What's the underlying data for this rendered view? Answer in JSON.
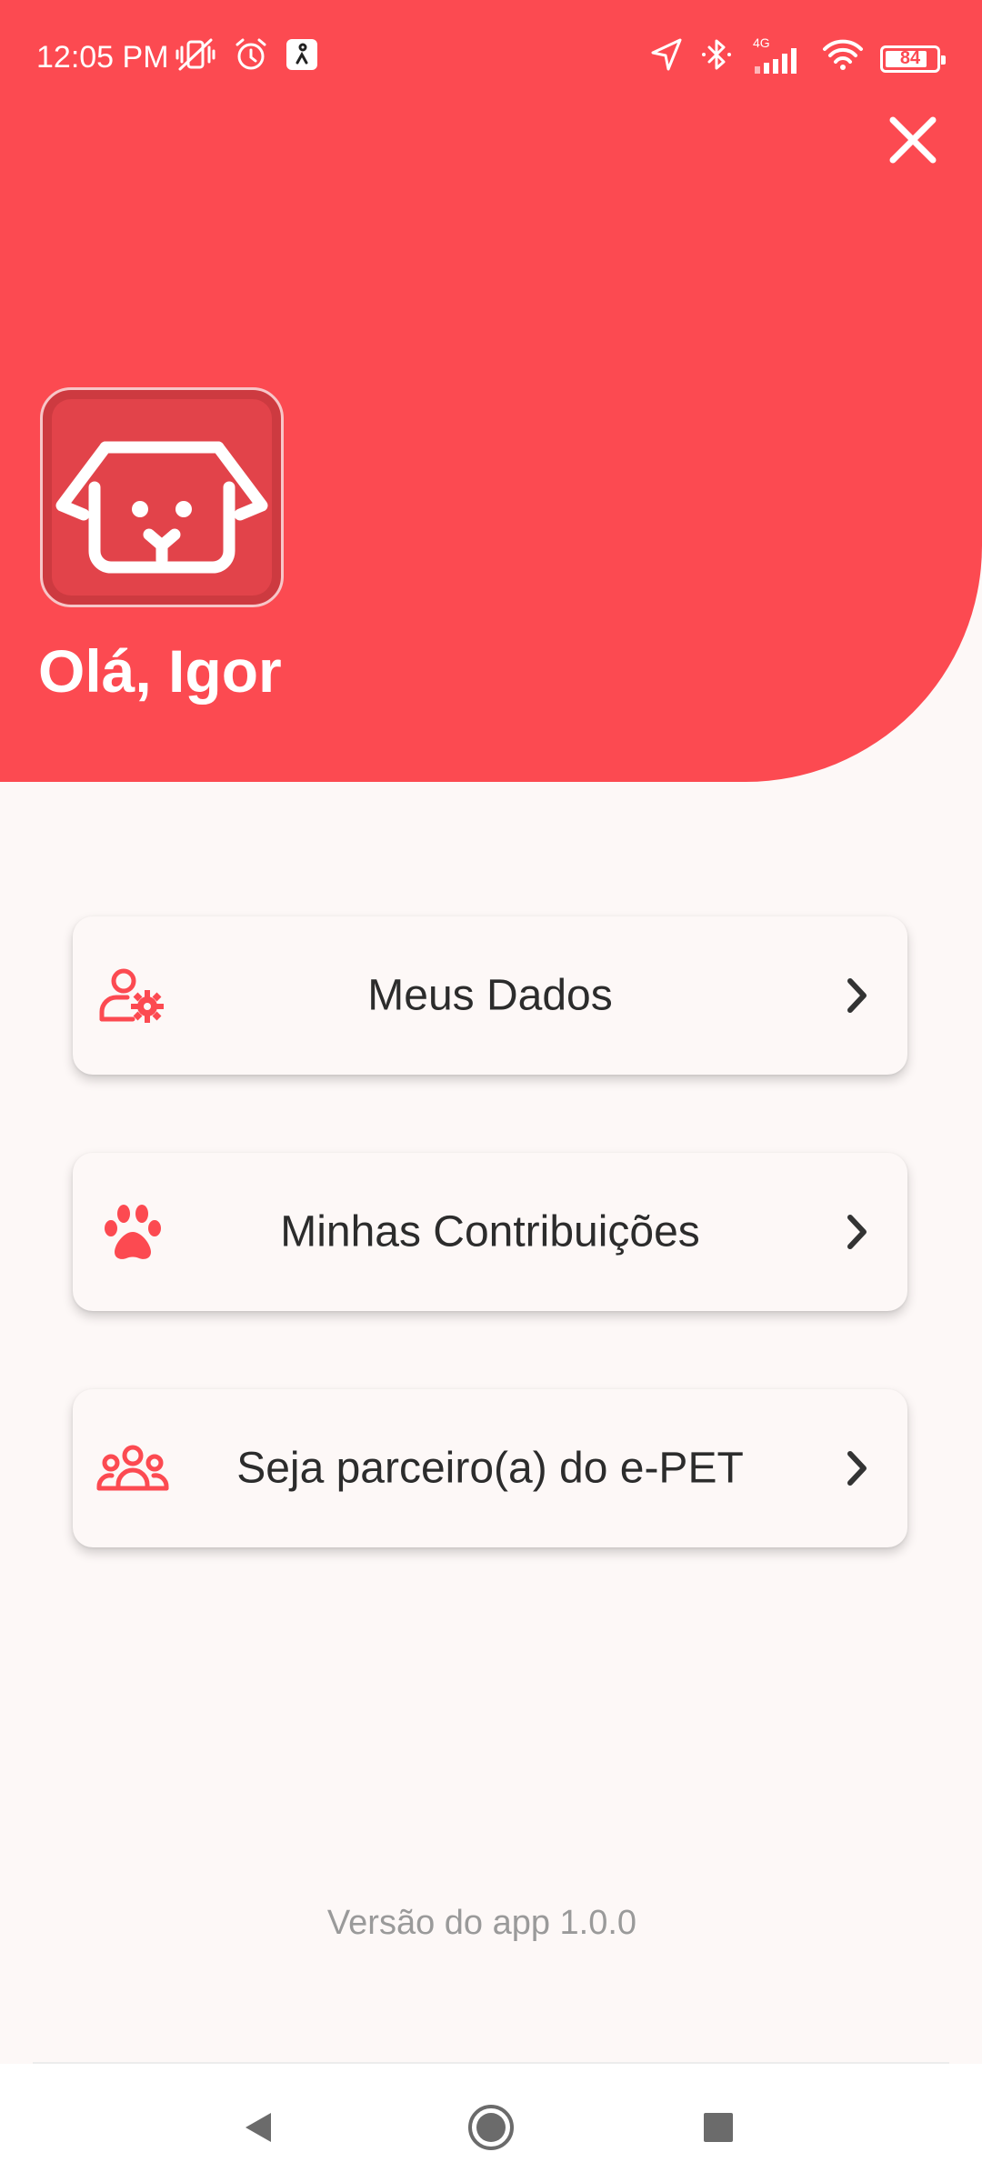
{
  "status_bar": {
    "time": "12:05 PM",
    "network": "4G",
    "battery": "84",
    "battery_level": 0.84,
    "icons": [
      "mute-vibrate-icon",
      "alarm-icon",
      "app-notification-icon",
      "location-icon",
      "bluetooth-icon",
      "signal-icon",
      "wifi-icon",
      "battery-icon"
    ]
  },
  "header": {
    "close_icon": "close-icon",
    "avatar_icon": "dog-face-icon",
    "greeting": "Olá, Igor"
  },
  "menu": {
    "items": [
      {
        "label": "Meus Dados",
        "icon": "user-settings-icon"
      },
      {
        "label": "Minhas Contribuições",
        "icon": "paw-icon"
      },
      {
        "label": "Seja parceiro(a) do e-PET",
        "icon": "group-icon"
      }
    ]
  },
  "footer": {
    "version": "Versão do app 1.0.0"
  },
  "nav_bar": {
    "buttons": [
      "back-icon",
      "home-icon",
      "recents-icon"
    ]
  },
  "colors": {
    "primary": "#fc4a51",
    "background": "#fdf8f7",
    "text": "#2c2c2c",
    "muted": "#9a9a9a"
  }
}
